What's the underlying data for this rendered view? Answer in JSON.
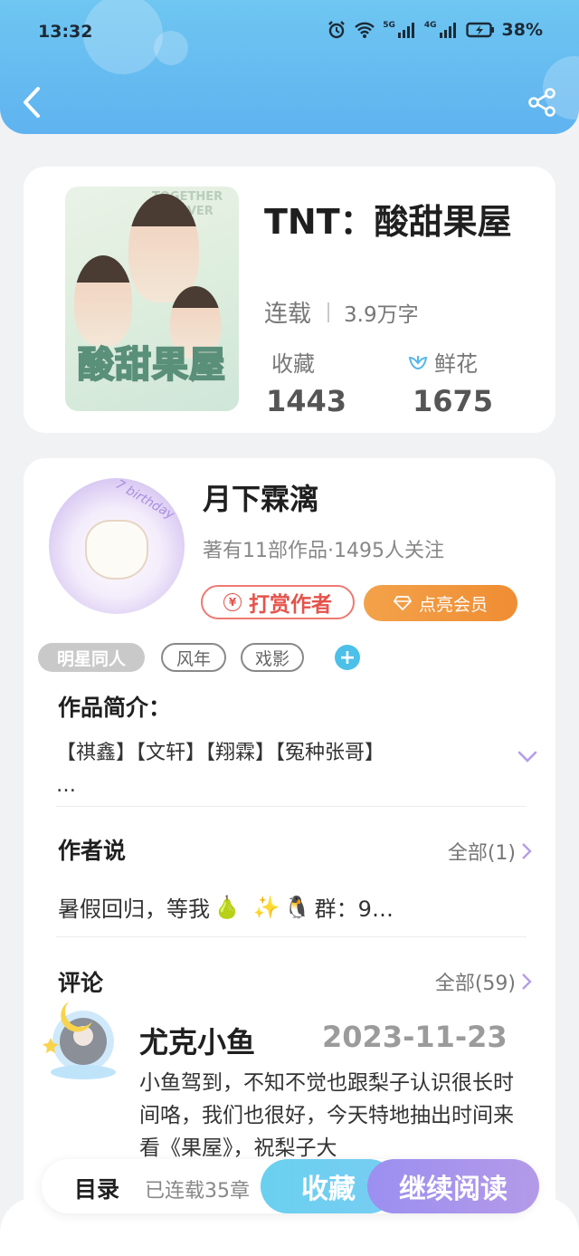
{
  "status_bar": {
    "time": "13:32",
    "network_1": "5G",
    "network_2": "4G",
    "battery": "38%"
  },
  "book": {
    "title": "TNT：酸甜果屋",
    "status": "连载",
    "word_count": "3.9万字",
    "favorites_label": "收藏",
    "favorites_value": "1443",
    "flowers_label": "鲜花",
    "flowers_value": "1675",
    "cover_title": "酸甜果屋",
    "cover_text": "TOGETHER FOREVER"
  },
  "author": {
    "name": "月下霖漓",
    "summary": "著有11部作品·1495人关注",
    "tip_button": "打赏作者",
    "vip_button": "点亮会员",
    "avatar_text": "7 birthday"
  },
  "tags": [
    "明星同人",
    "风年",
    "戏影"
  ],
  "intro": {
    "title": "作品简介：",
    "text": "【祺鑫】【文轩】【翔霖】【冤种张哥】",
    "ellipsis": "…"
  },
  "author_says": {
    "title": "作者说",
    "link": "全部(1)",
    "text": "暑假回归，等我",
    "emoji_1": "🍐",
    "emoji_2": "✨",
    "emoji_3": "🐧",
    "text_tail": "群：9…"
  },
  "comments": {
    "title": "评论",
    "link": "全部(59)",
    "items": [
      {
        "user": "尤克小鱼",
        "date": "2023-11-23",
        "text": "小鱼驾到，不知不觉也跟梨子认识很长时间咯，我们也很好，今天特地抽出时间来看《果屋》，祝梨子大"
      }
    ]
  },
  "bottom_bar": {
    "toc": "目录",
    "chapters": "已连载35章",
    "collect": "收藏",
    "continue": "继续阅读"
  },
  "colors": {
    "header": "#5fb3f0",
    "accent_blue": "#6ad0ef",
    "accent_purple": "#a794ee",
    "tip_red": "#e5534b",
    "vip_orange": "#ef8d33"
  },
  "icons": {
    "back": "chevron-left-icon",
    "share": "share-icon",
    "flower": "flower-icon",
    "expand": "chevron-down-icon",
    "more": "chevron-right-icon"
  }
}
